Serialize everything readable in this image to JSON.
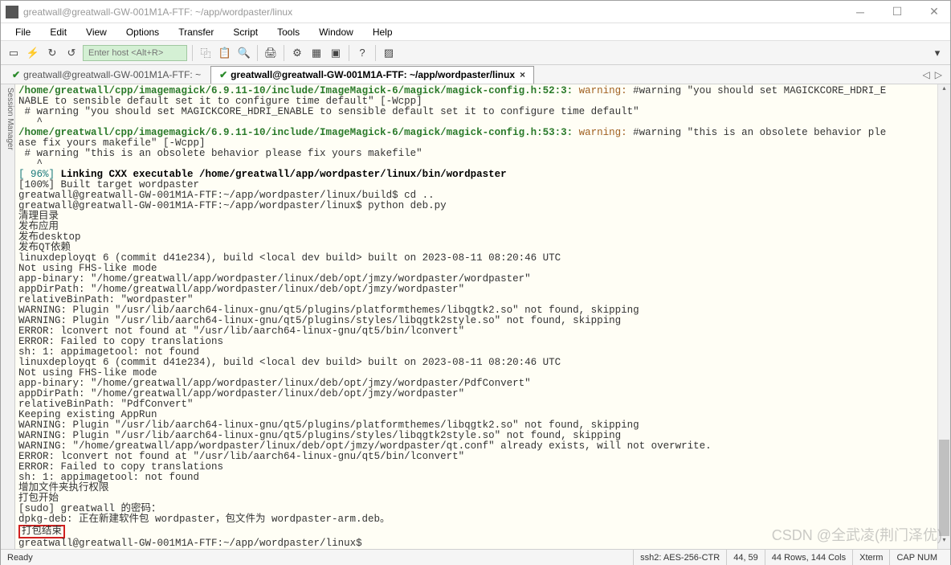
{
  "titlebar": {
    "title": "greatwall@greatwall-GW-001M1A-FTF: ~/app/wordpaster/linux"
  },
  "menu": {
    "items": [
      "File",
      "Edit",
      "View",
      "Options",
      "Transfer",
      "Script",
      "Tools",
      "Window",
      "Help"
    ]
  },
  "toolbar": {
    "host_placeholder": "Enter host <Alt+R>"
  },
  "tabs": {
    "items": [
      {
        "check": "✔",
        "label": "greatwall@greatwall-GW-001M1A-FTF: ~",
        "active": false
      },
      {
        "check": "✔",
        "label": "greatwall@greatwall-GW-001M1A-FTF: ~/app/wordpaster/linux",
        "active": true
      }
    ]
  },
  "sidebar": {
    "label": "Session Manager"
  },
  "term": {
    "l01a": "/home/greatwall/cpp/imagemagick/6.9.11-10/include/ImageMagick-6/magick/magick-config.h:52:3:",
    "l01w": " warning: ",
    "l01b": "#warning \"you should set MAGICKCORE_HDRI_E",
    "l02": "NABLE to sensible default set it to configure time default\" [-Wcpp]",
    "l03": " # warning \"you should set MAGICKCORE_HDRI_ENABLE to sensible default set it to configure time default\"",
    "l04": "   ^",
    "l05a": "/home/greatwall/cpp/imagemagick/6.9.11-10/include/ImageMagick-6/magick/magick-config.h:53:3:",
    "l05w": " warning: ",
    "l05b": "#warning \"this is an obsolete behavior ple",
    "l06": "ase fix yours makefile\" [-Wcpp]",
    "l07": " # warning \"this is an obsolete behavior please fix yours makefile\"",
    "l08": "   ^",
    "l09a": "[ 96%] ",
    "l09b": "Linking CXX executable /home/greatwall/app/wordpaster/linux/bin/wordpaster",
    "l10": "[100%] Built target wordpaster",
    "l11": "greatwall@greatwall-GW-001M1A-FTF:~/app/wordpaster/linux/build$ cd ..",
    "l12": "greatwall@greatwall-GW-001M1A-FTF:~/app/wordpaster/linux$ python deb.py",
    "l13": "清理目录",
    "l14": "发布应用",
    "l15": "发布desktop",
    "l16": "发布QT依赖",
    "l17": "linuxdeployqt 6 (commit d41e234), build <local dev build> built on 2023-08-11 08:20:46 UTC",
    "l18": "Not using FHS-like mode",
    "l19": "app-binary: \"/home/greatwall/app/wordpaster/linux/deb/opt/jmzy/wordpaster/wordpaster\"",
    "l20": "appDirPath: \"/home/greatwall/app/wordpaster/linux/deb/opt/jmzy/wordpaster\"",
    "l21": "relativeBinPath: \"wordpaster\"",
    "l22": "WARNING: Plugin \"/usr/lib/aarch64-linux-gnu/qt5/plugins/platformthemes/libqgtk2.so\" not found, skipping",
    "l23": "WARNING: Plugin \"/usr/lib/aarch64-linux-gnu/qt5/plugins/styles/libqgtk2style.so\" not found, skipping",
    "l24": "ERROR: lconvert not found at \"/usr/lib/aarch64-linux-gnu/qt5/bin/lconvert\"",
    "l25": "ERROR: Failed to copy translations",
    "l26": "sh: 1: appimagetool: not found",
    "l27": "linuxdeployqt 6 (commit d41e234), build <local dev build> built on 2023-08-11 08:20:46 UTC",
    "l28": "Not using FHS-like mode",
    "l29": "app-binary: \"/home/greatwall/app/wordpaster/linux/deb/opt/jmzy/wordpaster/PdfConvert\"",
    "l30": "appDirPath: \"/home/greatwall/app/wordpaster/linux/deb/opt/jmzy/wordpaster\"",
    "l31": "relativeBinPath: \"PdfConvert\"",
    "l32": "Keeping existing AppRun",
    "l33": "WARNING: Plugin \"/usr/lib/aarch64-linux-gnu/qt5/plugins/platformthemes/libqgtk2.so\" not found, skipping",
    "l34": "WARNING: Plugin \"/usr/lib/aarch64-linux-gnu/qt5/plugins/styles/libqgtk2style.so\" not found, skipping",
    "l35": "WARNING: \"/home/greatwall/app/wordpaster/linux/deb/opt/jmzy/wordpaster/qt.conf\" already exists, will not overwrite.",
    "l36": "ERROR: lconvert not found at \"/usr/lib/aarch64-linux-gnu/qt5/bin/lconvert\"",
    "l37": "ERROR: Failed to copy translations",
    "l38": "sh: 1: appimagetool: not found",
    "l39": "增加文件夹执行权限",
    "l40": "打包开始",
    "l41": "[sudo] greatwall 的密码：",
    "l42": "dpkg-deb: 正在新建软件包 wordpaster，包文件为 wordpaster-arm.deb。",
    "l43": "打包结束",
    "l44": "greatwall@greatwall-GW-001M1A-FTF:~/app/wordpaster/linux$ "
  },
  "status": {
    "ready": "Ready",
    "ssh": "ssh2: AES-256-CTR",
    "pos": "44,  59",
    "size": "44 Rows, 144 Cols",
    "term": "Xterm",
    "caps": "CAP  NUM"
  },
  "watermark": "CSDN @全武凌(荆门泽优)"
}
